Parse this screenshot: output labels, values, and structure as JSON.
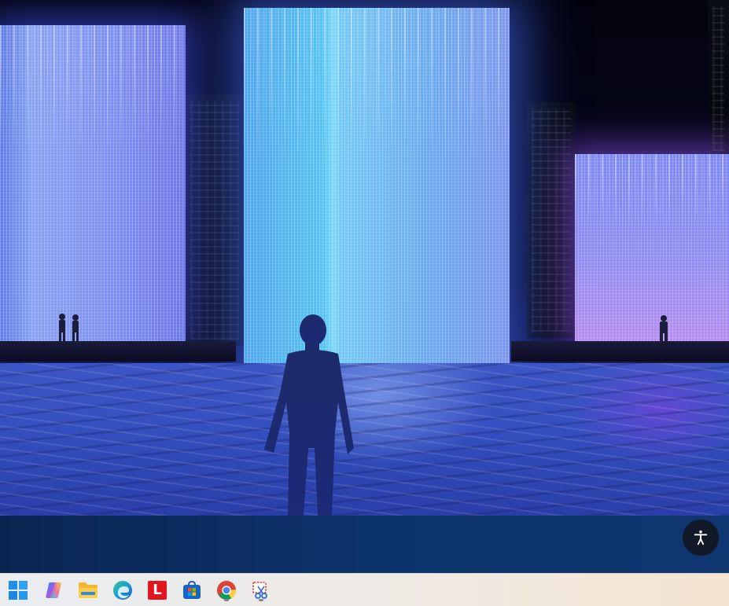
{
  "wallpaper": {
    "scene": "illuminated-water-curtain-cubes",
    "colors": {
      "sky": "#03030f",
      "cube_blue": "#56c3f2",
      "cube_violet": "#b58cf0",
      "water": "#3550c0"
    }
  },
  "page_band": {
    "color": "#0d336b",
    "accessibility_button": {
      "icon": "accessibility-person-icon",
      "background": "#111827",
      "icon_color": "#ffffff"
    }
  },
  "taskbar": {
    "icons": [
      {
        "name": "start-button",
        "icon": "windows-logo-icon",
        "running": false
      },
      {
        "name": "copilot-button",
        "icon": "copilot-icon",
        "running": false
      },
      {
        "name": "file-explorer-button",
        "icon": "folder-icon",
        "running": false
      },
      {
        "name": "edge-button",
        "icon": "edge-browser-icon",
        "running": false
      },
      {
        "name": "l-app-button",
        "icon": "red-l-app-icon",
        "glyph": "L",
        "running": false
      },
      {
        "name": "store-button",
        "icon": "microsoft-store-icon",
        "running": false
      },
      {
        "name": "chrome-button",
        "icon": "chrome-browser-icon",
        "running": true
      },
      {
        "name": "snipping-tool-button",
        "icon": "snipping-tool-icon",
        "running": true
      }
    ]
  }
}
